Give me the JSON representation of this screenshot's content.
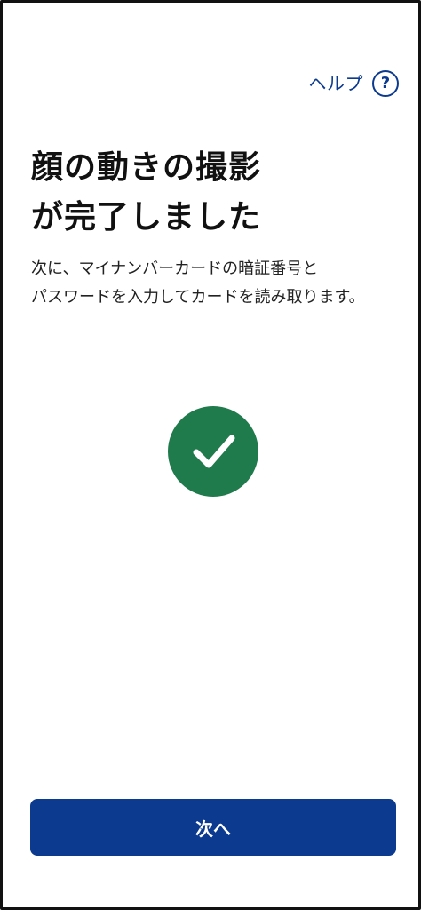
{
  "header": {
    "help_label": "ヘルプ",
    "help_icon": "question-circle-icon",
    "help_icon_glyph": "?"
  },
  "main": {
    "title": "顔の動きの撮影\nが完了しました",
    "description": "次に、マイナンバーカードの暗証番号と\nパスワードを入力してカードを読み取ります。",
    "status_icon": "check-circle-icon"
  },
  "footer": {
    "next_label": "次へ"
  },
  "colors": {
    "accent": "#0b3a8f",
    "success": "#1f7a4c",
    "background": "#ffffff",
    "text": "#111111"
  }
}
